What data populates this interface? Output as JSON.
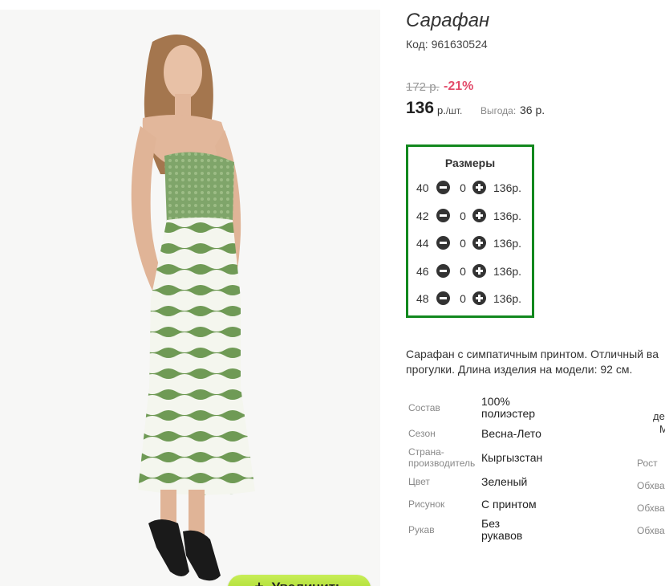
{
  "product": {
    "title": "Сарафан",
    "code_label": "Код:",
    "code": "961630524",
    "code_text": "Код: 961630524"
  },
  "pricing": {
    "old_price": "172 р.",
    "discount": "-21%",
    "price": "136",
    "currency": "р.",
    "per_unit": "/шт.",
    "profit_label": "Выгода:",
    "profit_value": "36 р.",
    "discount_color": "#e34c6b"
  },
  "sizes": {
    "title": "Размеры",
    "border_color": "#12881e",
    "rows": [
      {
        "size": "40",
        "qty": "0",
        "price": "136р."
      },
      {
        "size": "42",
        "qty": "0",
        "price": "136р."
      },
      {
        "size": "44",
        "qty": "0",
        "price": "136р."
      },
      {
        "size": "46",
        "qty": "0",
        "price": "136р."
      },
      {
        "size": "48",
        "qty": "0",
        "price": "136р."
      }
    ],
    "minus_icon": "minus-circle-icon",
    "plus_icon": "plus-circle-icon"
  },
  "description": {
    "line1": "Сарафан с симпатичным принтом. Отличный ва",
    "line2": "прогулки. Длина изделия на модели: 92 см."
  },
  "attributes": [
    {
      "label": "Состав",
      "value": "100% полиэстер"
    },
    {
      "label": "Сезон",
      "value": "Весна-Лето"
    },
    {
      "label": "Страна-производитель",
      "value": "Кыргызстан"
    },
    {
      "label": "Цвет",
      "value": "Зеленый"
    },
    {
      "label": "Рисунок",
      "value": "С принтом"
    },
    {
      "label": "Рукав",
      "value": "Без рукавов"
    }
  ],
  "size_chart_cut": {
    "header1": "де",
    "header2": "М",
    "labels": [
      "Рост",
      "Обхва",
      "Обхва",
      "Обхва"
    ]
  },
  "zoom_button": {
    "label": "Увеличить",
    "icon": "plus-icon",
    "color": "#9ed21a"
  },
  "photo": {
    "icon": "product-photo-dress-icon",
    "dress_color": "#6f9a55"
  }
}
